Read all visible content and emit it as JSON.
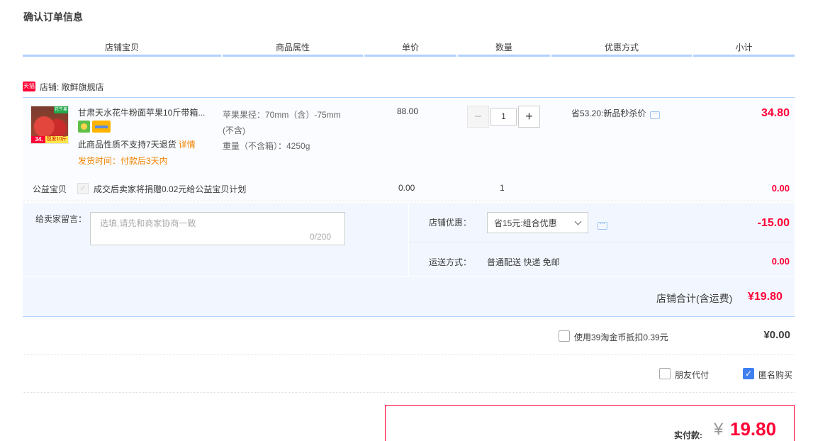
{
  "page": {
    "title": "确认订单信息"
  },
  "columns": [
    "店铺宝贝",
    "商品属性",
    "单价",
    "数量",
    "优惠方式",
    "小计"
  ],
  "shop": {
    "badge": "天猫",
    "name": "店铺: 敞鲜旗舰店"
  },
  "item": {
    "title": "甘肃天水花牛粉面苹果10斤带箱...",
    "thumb_labels": [
      "34.",
      "现发10斤",
      "花牛果"
    ],
    "return_note": "此商品性质不支持7天退货",
    "detail_link": "详情",
    "ship_time": "发货时间：付款后3天内",
    "attr_line1": "苹果果径：70mm（含）-75mm",
    "attr_line2": "(不含)",
    "attr_line3": "重量（不含箱）：4250g",
    "price": "88.00",
    "qty": "1",
    "minus": "−",
    "plus": "+",
    "promo": "省53.20:新品秒杀价",
    "subtotal": "34.80"
  },
  "charity": {
    "label": "公益宝贝",
    "check": "✓",
    "text": "成交后卖家将捐赠0.02元给公益宝贝计划",
    "price": "0.00",
    "qty": "1",
    "subtotal": "0.00"
  },
  "message": {
    "label": "给卖家留言：",
    "placeholder": "选填,请先和商家协商一致",
    "count": "0/200"
  },
  "shop_discount": {
    "label": "店铺优惠：",
    "selected": "省15元:组合优惠",
    "value": "-15.00"
  },
  "delivery": {
    "label": "运送方式：",
    "value": "普通配送 快递 免邮",
    "price": "0.00"
  },
  "shop_total": {
    "label": "店铺合计(含运费)",
    "value": "¥19.80"
  },
  "coins": {
    "text": "使用39淘金币抵扣0.39元",
    "value": "¥0.00"
  },
  "options": {
    "friend": "朋友代付",
    "anon": "匿名购买",
    "anon_check": "✓"
  },
  "pay": {
    "label": "实付款:",
    "currency": "¥",
    "value": "19.80"
  },
  "colors": {
    "accent": "#ff0036",
    "header_border": "#b2d1ff",
    "panel": "#f2f7ff"
  }
}
